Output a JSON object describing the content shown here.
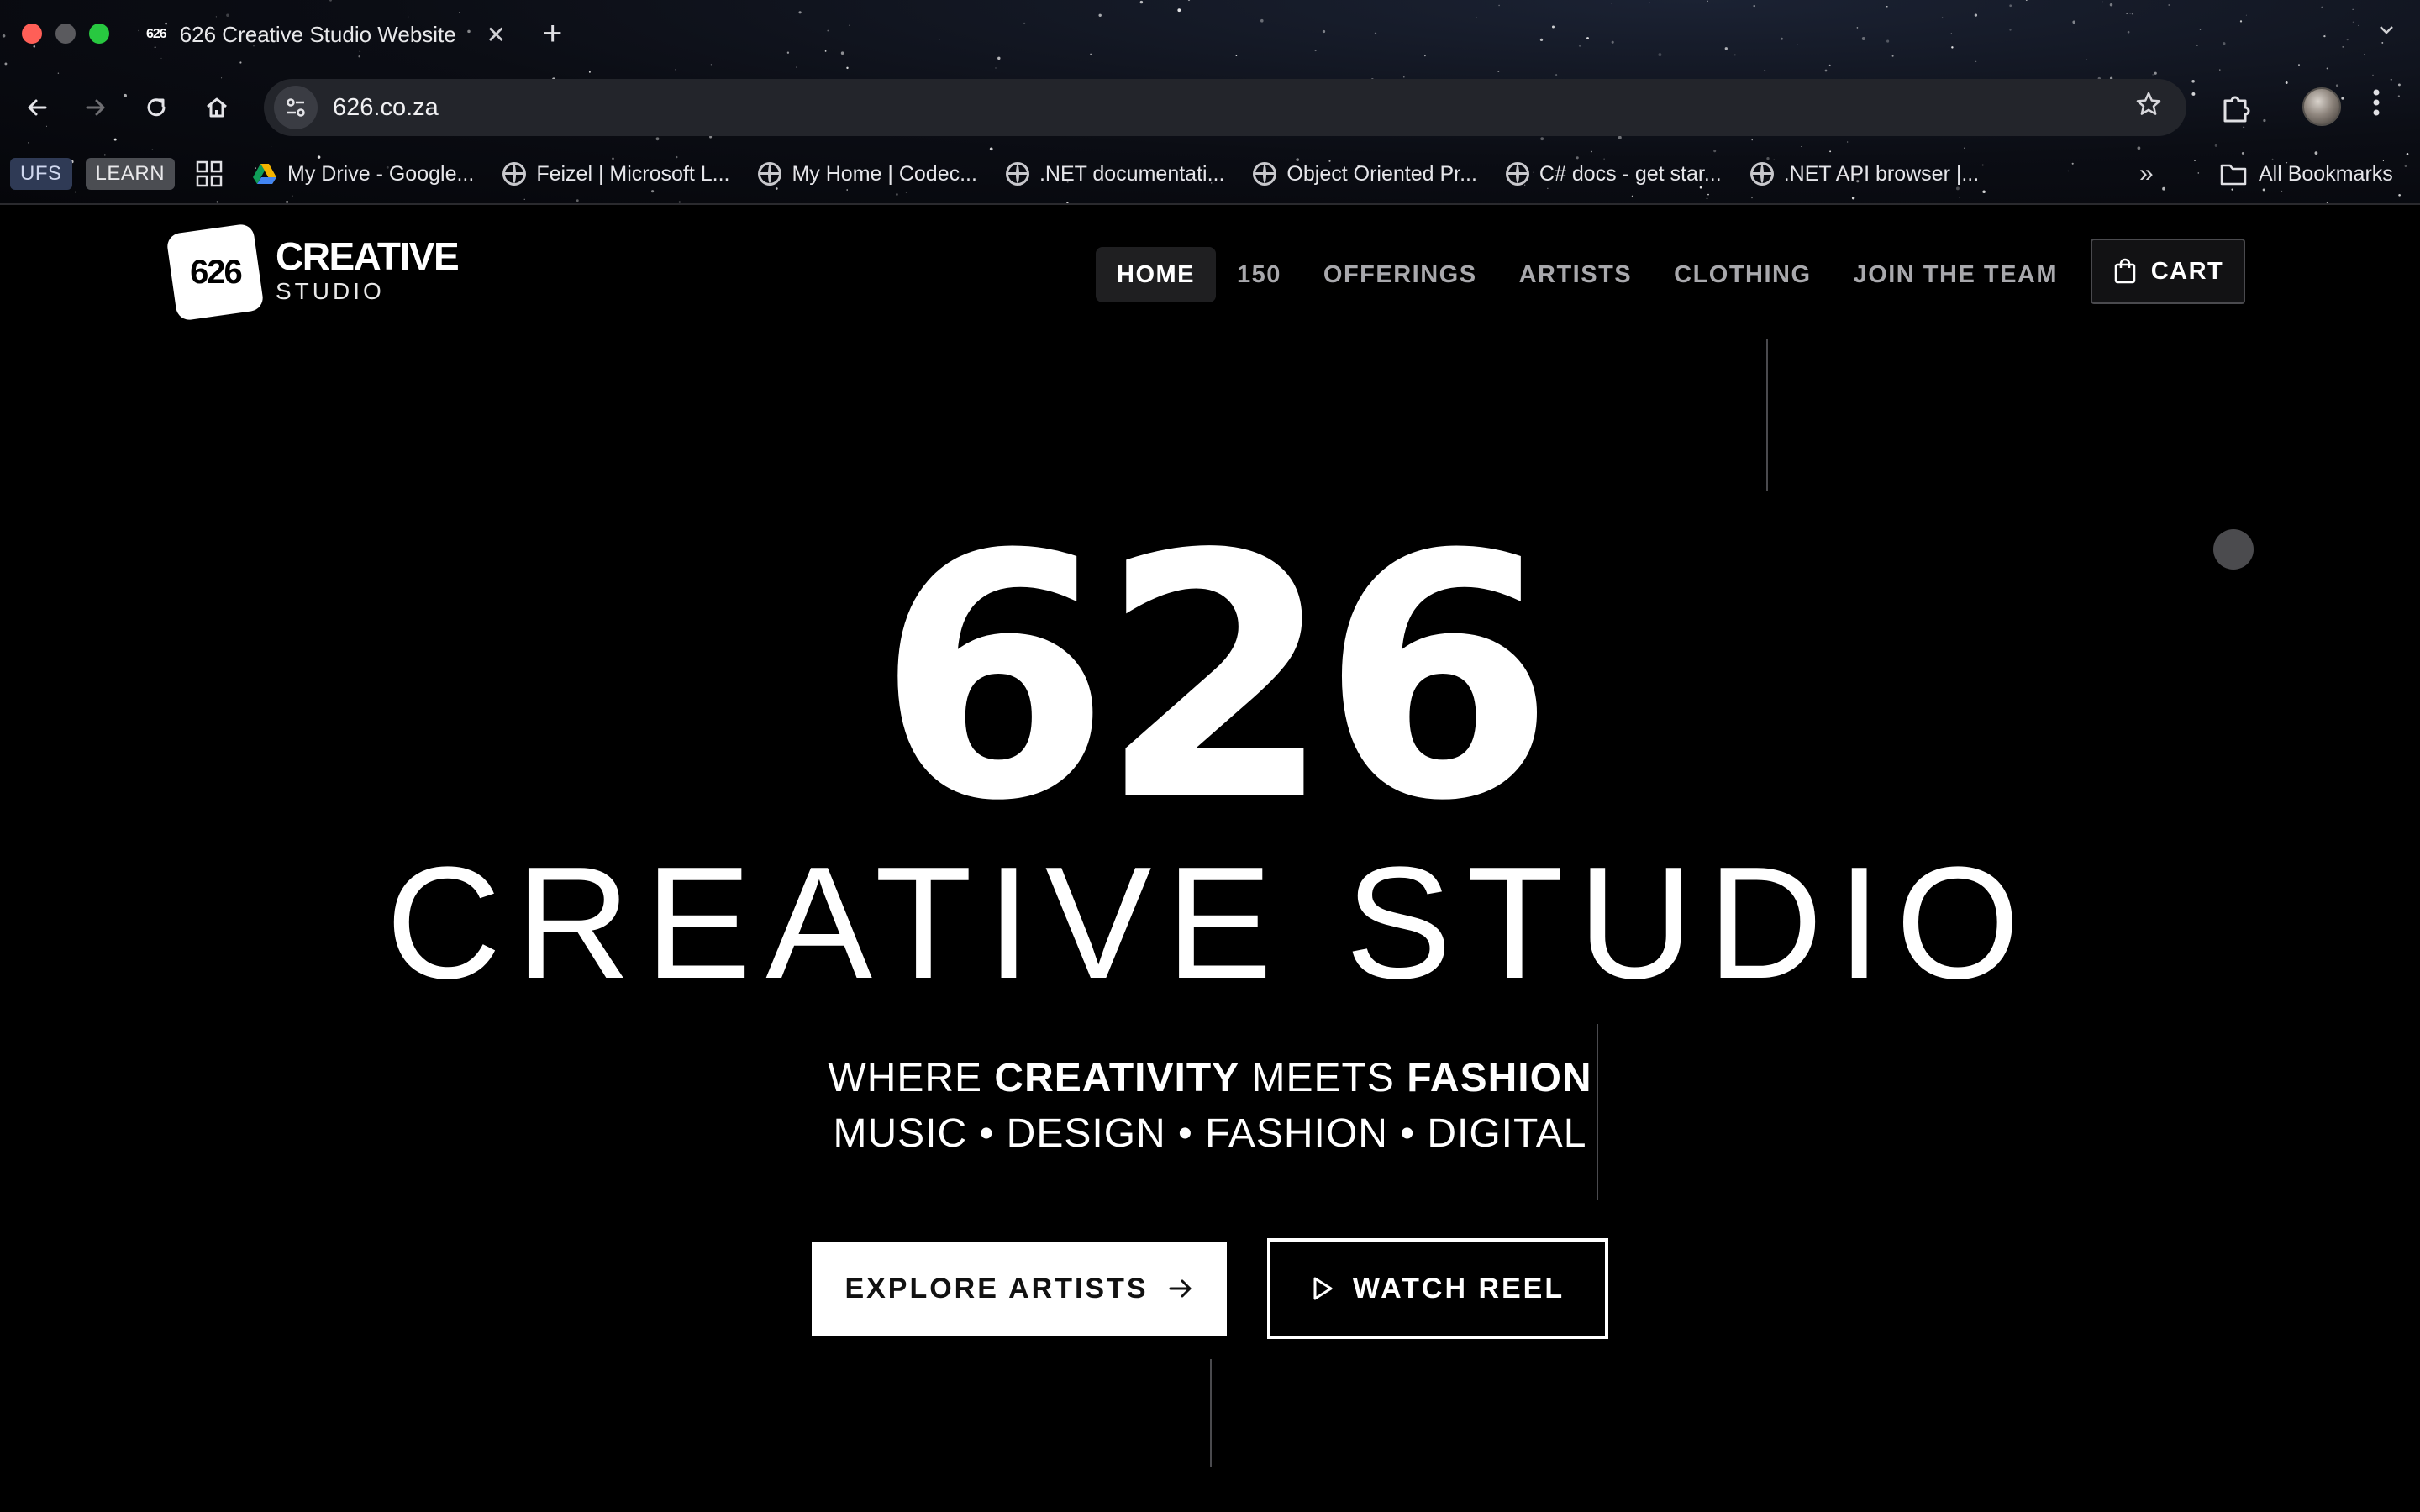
{
  "browser": {
    "tab_title": "626 Creative Studio Website",
    "tab_favicon_text": "626",
    "new_tab_label": "+",
    "close_label": "✕",
    "url": "626.co.za",
    "bookmarks_chips": [
      "UFS",
      "LEARN"
    ],
    "bookmarks": [
      "My Drive - Google...",
      "Feizel | Microsoft L...",
      "My Home | Codec...",
      ".NET documentati...",
      "Object Oriented Pr...",
      "C# docs - get star...",
      ".NET API browser |..."
    ],
    "bookmarks_overflow": "»",
    "all_bookmarks": "All Bookmarks"
  },
  "site": {
    "logo_badge": "626",
    "logo_creative": "CREATIVE",
    "logo_studio": "STUDIO",
    "nav": [
      "HOME",
      "150",
      "OFFERINGS",
      "ARTISTS",
      "CLOTHING",
      "JOIN THE TEAM"
    ],
    "nav_active": "HOME",
    "cart_label": "CART"
  },
  "hero": {
    "big_number": "626",
    "headline": "CREATIVE STUDIO",
    "tagline_parts": [
      "WHERE ",
      "CREATIVITY",
      " MEETS ",
      "FASHION"
    ],
    "disciplines": "MUSIC • DESIGN • FASHION • DIGITAL",
    "explore_label": "EXPLORE ARTISTS",
    "reel_label": "WATCH REEL"
  },
  "colors": {
    "background": "#000000",
    "text": "#ffffff",
    "nav_inactive": "#a8a8ac",
    "omnibox": "#23252b"
  }
}
